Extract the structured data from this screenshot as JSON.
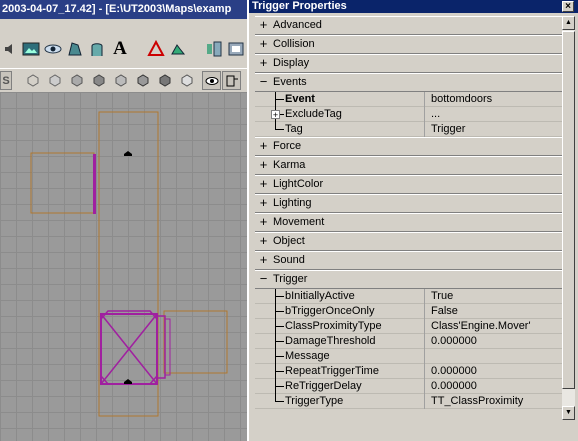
{
  "editor": {
    "title": "2003-04-07_17.42] - [E:\\UT2003\\Maps\\examp",
    "toolbar_text_icon": "A",
    "toolbar2_s_label": "S"
  },
  "properties": {
    "title": "Trigger Properties",
    "close_glyph": "×",
    "categories": [
      {
        "label": "Advanced",
        "expanded": false
      },
      {
        "label": "Collision",
        "expanded": false
      },
      {
        "label": "Display",
        "expanded": false
      },
      {
        "label": "Events",
        "expanded": true
      },
      {
        "label": "Force",
        "expanded": false
      },
      {
        "label": "Karma",
        "expanded": false
      },
      {
        "label": "LightColor",
        "expanded": false
      },
      {
        "label": "Lighting",
        "expanded": false
      },
      {
        "label": "Movement",
        "expanded": false
      },
      {
        "label": "Object",
        "expanded": false
      },
      {
        "label": "Sound",
        "expanded": false
      },
      {
        "label": "Trigger",
        "expanded": true
      }
    ],
    "events": [
      {
        "name": "Event",
        "value": "bottomdoors",
        "bold": true
      },
      {
        "name": "ExcludeTag",
        "value": "...",
        "expandable": true
      },
      {
        "name": "Tag",
        "value": "Trigger"
      }
    ],
    "trigger": [
      {
        "name": "bInitiallyActive",
        "value": "True"
      },
      {
        "name": "bTriggerOnceOnly",
        "value": "False"
      },
      {
        "name": "ClassProximityType",
        "value": "Class'Engine.Mover'"
      },
      {
        "name": "DamageThreshold",
        "value": "0.000000"
      },
      {
        "name": "Message",
        "value": ""
      },
      {
        "name": "RepeatTriggerTime",
        "value": "0.000000"
      },
      {
        "name": "ReTriggerDelay",
        "value": "0.000000"
      },
      {
        "name": "TriggerType",
        "value": "TT_ClassProximity"
      }
    ],
    "plus_glyph": "+",
    "minus_glyph": "−"
  },
  "colors": {
    "title_active": "#0a246a",
    "title_inactive": "#2a3f86",
    "mover_wire": "#a020a0",
    "volume_outline": "#b07830",
    "viewport_bg": "#9a9a9a"
  }
}
